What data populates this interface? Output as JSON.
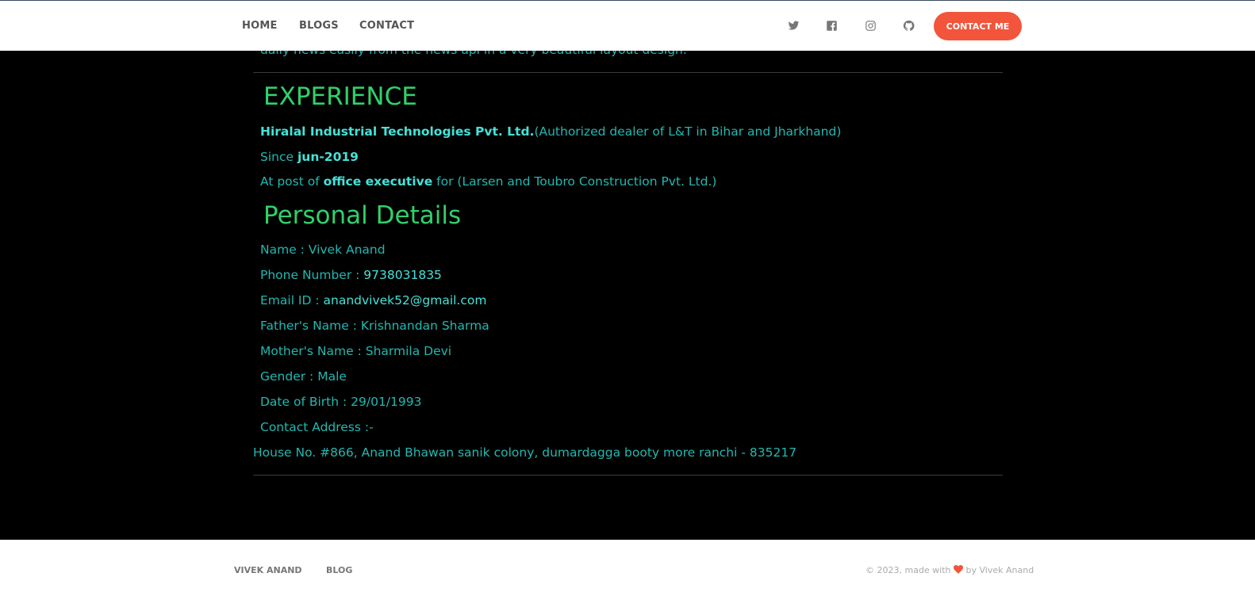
{
  "colors": {
    "accent": "#f2553b",
    "heading": "#2fd16a",
    "text": "#22b8b0",
    "highlight": "#44e2d8",
    "background": "#000000"
  },
  "nav": {
    "links": [
      "HOME",
      "BLOGS",
      "CONTACT"
    ],
    "social_icons": [
      "twitter-icon",
      "facebook-square-icon",
      "instagram-icon",
      "github-icon"
    ],
    "cta_label": "CONTACT ME"
  },
  "intro_tail": "daily news easily from the news api in a very beautiful layout design.",
  "experience": {
    "title": "EXPERIENCE",
    "company": "Hiralal Industrial Technologies Pvt. Ltd.",
    "company_note": "(Authorized dealer of L&T in Bihar and Jharkhand)",
    "since_label": "Since ",
    "since_value": "jun-2019",
    "post_prefix": "At post of ",
    "post_value": "office executive",
    "post_suffix": " for (Larsen and Toubro Construction Pvt. Ltd.)"
  },
  "personal": {
    "title": "Personal Details",
    "name": "Name : Vivek Anand",
    "phone_label": "Phone Number : ",
    "phone_value": "9738031835",
    "email_label": "Email ID : ",
    "email_value": "anandvivek52@gmail.com",
    "father": "Father's Name : Krishnandan Sharma",
    "mother": "Mother's Name : Sharmila Devi",
    "gender": "Gender : Male",
    "dob": "Date of Birth : 29/01/1993",
    "address_label": "Contact Address :-",
    "address": "House No. #866, Anand Bhawan sanik colony, dumardagga booty more ranchi - 835217"
  },
  "footer": {
    "links": [
      "VIVEK ANAND",
      "BLOG"
    ],
    "copy_prefix": "© 2023, made with",
    "copy_suffix": "by Vivek Anand",
    "heart_icon": "heart-icon"
  }
}
